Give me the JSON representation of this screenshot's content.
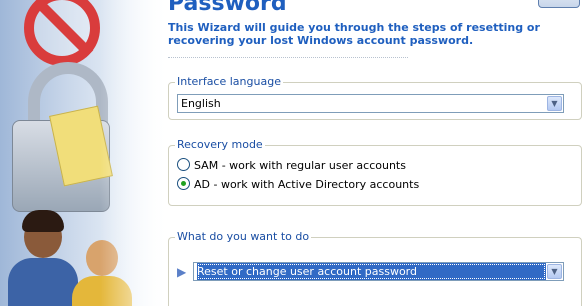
{
  "wizard": {
    "title": "Password",
    "description": "This Wizard will guide you through the steps of resetting or recovering your lost Windows account password."
  },
  "interface_language": {
    "legend": "Interface language",
    "selected": "English"
  },
  "recovery_mode": {
    "legend": "Recovery mode",
    "options": [
      {
        "label": "SAM - work with regular user accounts",
        "selected": false
      },
      {
        "label": "AD - work with Active Directory accounts",
        "selected": true
      }
    ]
  },
  "action": {
    "legend": "What do you want to do",
    "selected": "Reset or change user account password"
  },
  "icons": {
    "dropdown": "chevron-down-icon",
    "action": "play-arrow-icon"
  },
  "colors": {
    "title": "#1f5fbf",
    "legend": "#1a4ea3",
    "selection": "#316ac5"
  }
}
